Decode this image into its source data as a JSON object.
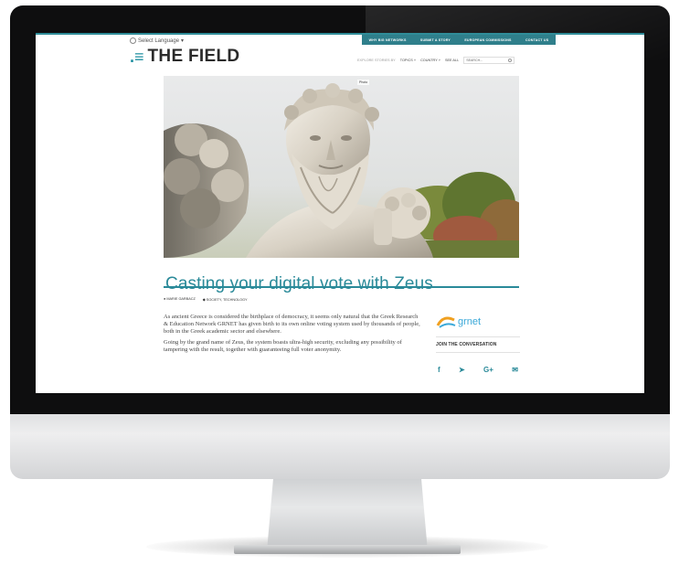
{
  "top": {
    "language_label": "Select Language",
    "nav": [
      "WHY BIG NETWORKS",
      "SUBMIT A STORY",
      "EUROPEAN COMMISSIONS",
      "CONTACT US"
    ]
  },
  "header": {
    "logo_mark": ".≡",
    "logo_text": "THE FIELD",
    "subnav": {
      "explore_label": "EXPLORE STORIES BY",
      "topics": "TOPICS ˅",
      "country": "COUNTRY ˅",
      "see_all": "SEE ALL"
    },
    "search_placeholder": "SEARCH..."
  },
  "hero": {
    "credit": "Photo"
  },
  "article": {
    "title": "Casting your digital vote with Zeus",
    "author": "MARIE GARBACZ",
    "category": "SOCIETY, TECHNOLOGY",
    "paragraphs": [
      "As ancient Greece is considered the birthplace of democracy, it seems only natural that the Greek Research & Education Network GRNET has given birth to its own online voting system used by thousands of people, both in the Greek academic sector and elsewhere.",
      "Going by the grand name of Zeus, the system boasts ultra-high security, excluding any possibility of tampering with the result, together with guaranteeing full voter anonymity."
    ]
  },
  "sidebar": {
    "partner": "grnet",
    "join_label": "JOIN THE CONVERSATION",
    "social": [
      "f",
      "🐦",
      "G+",
      "✉"
    ]
  },
  "colors": {
    "accent": "#2a8a99",
    "nav_bg": "#2f7f8b",
    "grnet": "#3aa8d8"
  }
}
